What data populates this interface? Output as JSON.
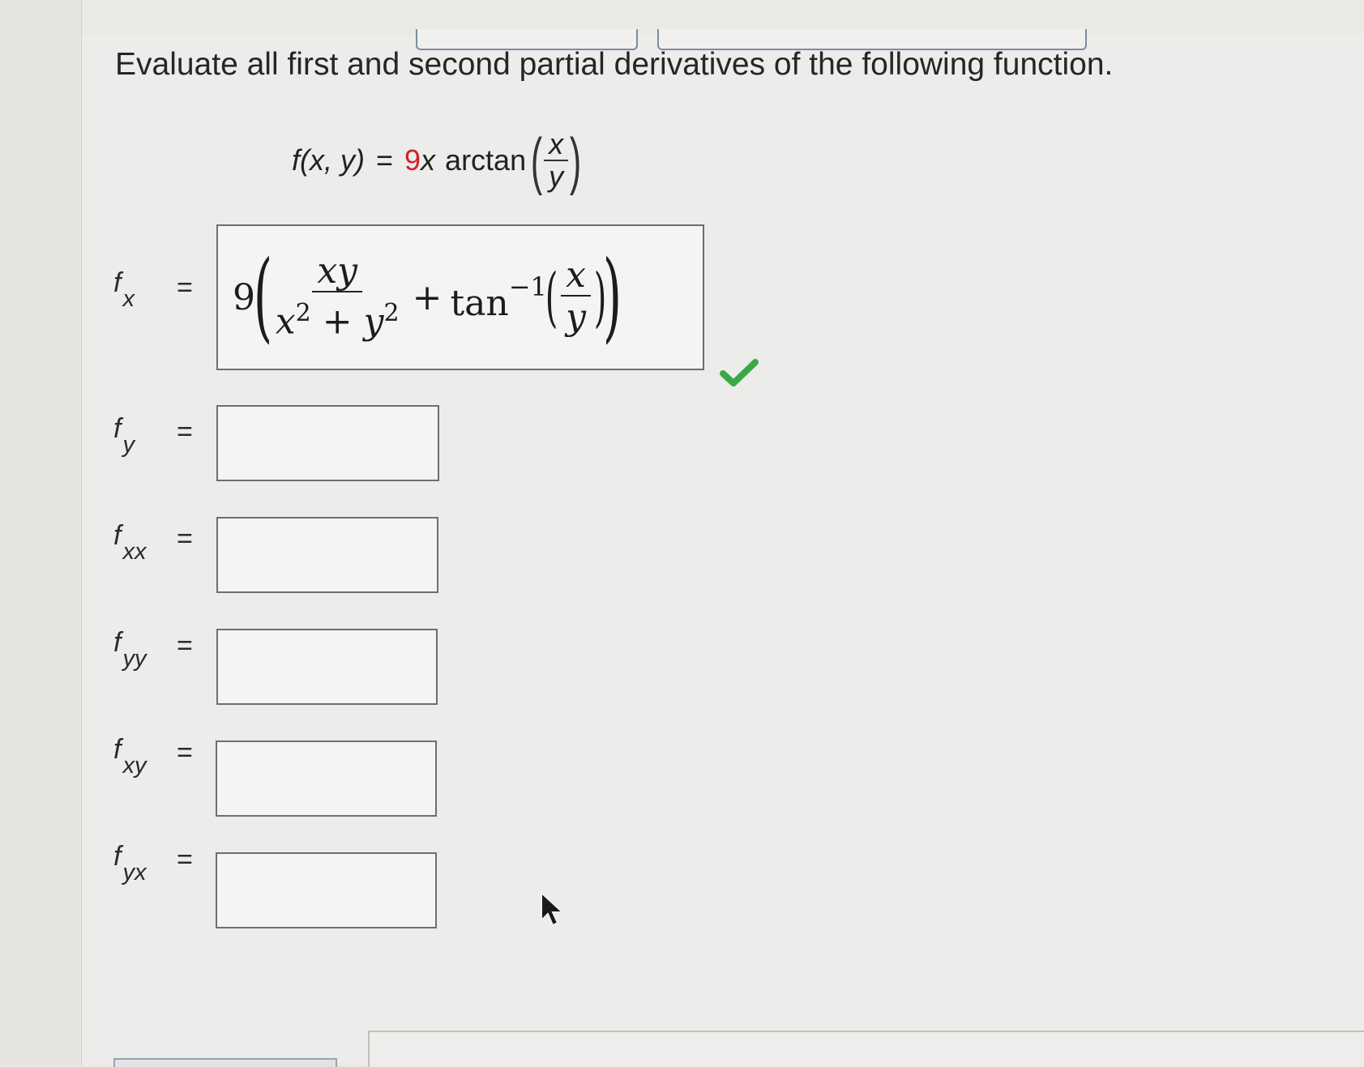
{
  "prompt": "Evaluate all first and second partial derivatives of the following function.",
  "function": {
    "lhs": "f(x, y)",
    "equals": "=",
    "coefficient": "9",
    "var": "x",
    "fn_name": "arctan",
    "frac_num": "x",
    "frac_den": "y"
  },
  "answers": [
    {
      "symbol": "f",
      "subscript": "x",
      "equals": "=",
      "status": "correct"
    },
    {
      "symbol": "f",
      "subscript": "y",
      "equals": "=",
      "value": ""
    },
    {
      "symbol": "f",
      "subscript": "xx",
      "equals": "=",
      "value": ""
    },
    {
      "symbol": "f",
      "subscript": "yy",
      "equals": "=",
      "value": ""
    },
    {
      "symbol": "f",
      "subscript": "xy",
      "equals": "=",
      "value": ""
    },
    {
      "symbol": "f",
      "subscript": "yx",
      "equals": "=",
      "value": ""
    }
  ],
  "fx_answer": {
    "coefficient": "9",
    "term1_num": "xy",
    "term1_den_a": "x",
    "exp_a": "2",
    "plus": "+",
    "term1_den_b": "y",
    "exp_b": "2",
    "plus2": "+",
    "fn": "tan",
    "fn_exp": "−1",
    "inner_num": "x",
    "inner_den": "y"
  },
  "colors": {
    "red_coefficient": "#d0202a",
    "check_green": "#3aa845",
    "box_border": "#6e6e6e"
  },
  "icons": {
    "check": "checkmark-icon",
    "cursor": "mouse-pointer-icon"
  }
}
